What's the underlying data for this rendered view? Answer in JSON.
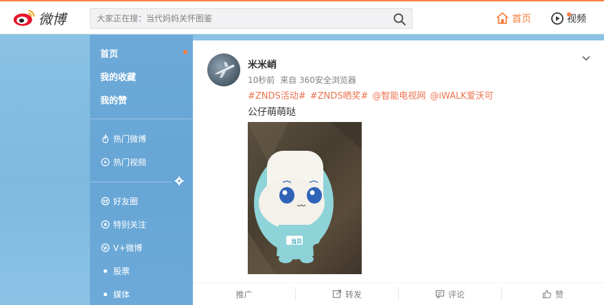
{
  "header": {
    "logo_text": "微博",
    "search_placeholder": "大家正在搜：当代妈妈关怀图鉴",
    "nav_home": "首页",
    "nav_video": "视频"
  },
  "sidebar": {
    "items": [
      {
        "label": "首页",
        "icon": "none"
      },
      {
        "label": "我的收藏",
        "icon": "none"
      },
      {
        "label": "我的赞",
        "icon": "none"
      },
      {
        "label": "热门微博",
        "icon": "flame-icon"
      },
      {
        "label": "热门视频",
        "icon": "play-icon"
      },
      {
        "label": "好友圈",
        "icon": "friends-icon"
      },
      {
        "label": "特别关注",
        "icon": "eye-icon"
      },
      {
        "label": "V+微博",
        "icon": "vplus-icon"
      },
      {
        "label": "股票",
        "icon": "dot-icon"
      },
      {
        "label": "媒体",
        "icon": "dot-icon"
      }
    ]
  },
  "post": {
    "username": "米米峭",
    "time": "10秒前",
    "source": "来自 360安全浏览器",
    "tags": [
      "#ZNDS活动#",
      "#ZNDS晒奖#",
      "@智能电视网",
      "@iWALK爱沃可"
    ],
    "text": "公仔萌萌哒",
    "image_badge": "当贝"
  },
  "actions": {
    "promote": "推广",
    "repost": "转发",
    "comment": "评论",
    "like": "赞"
  },
  "colors": {
    "accent": "#fa7d3c",
    "link": "#eb7350",
    "sidebar_bg": "#5496cd"
  }
}
